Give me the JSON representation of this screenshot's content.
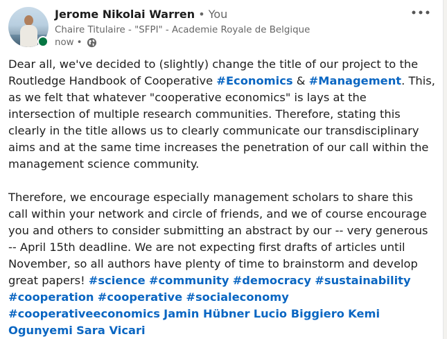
{
  "post": {
    "author": {
      "name": "Jerome Nikolai Warren",
      "you_label": "• You",
      "headline": "Chaire Titulaire - \"SFPI\" - Academie Royale de Belgique",
      "timestamp": "now",
      "visibility_icon": "globe-icon",
      "online_status_color": "#057642"
    },
    "more_icon": "more-horizontal-icon",
    "accent_color": "#0a66c2",
    "p1": {
      "t1": "Dear all, we've decided to (slightly) change the title of our project to the Routledge Handbook of Cooperative ",
      "tag_economics": "#Economics",
      "t2": " & ",
      "tag_management": "#Management",
      "t3": ". This, as we felt that whatever \"cooperative economics\" is lays at the intersection of multiple research communities. Therefore, stating this clearly in the title allows us to clearly communicate our transdisciplinary aims and at the same time increases the penetration of our call within the management science community."
    },
    "p2": {
      "t1": "Therefore, we encourage especially management scholars to share this call within your network and circle of friends, and we of course encourage you and others to consider submitting an abstract by our -- very generous -- April 15th deadline. We are not expecting first drafts of articles until November, so all authors have plenty of time to brainstorm and develop great papers! ",
      "hashtags": [
        "#science",
        "#community",
        "#democracy",
        "#sustainability",
        "#cooperation",
        "#cooperative",
        "#socialeconomy",
        "#cooperativeeconomics"
      ],
      "mentions": [
        "Jamin Hübner",
        "Lucio Biggiero",
        "Kemi Ogunyemi",
        "Sara Vicari"
      ]
    }
  }
}
